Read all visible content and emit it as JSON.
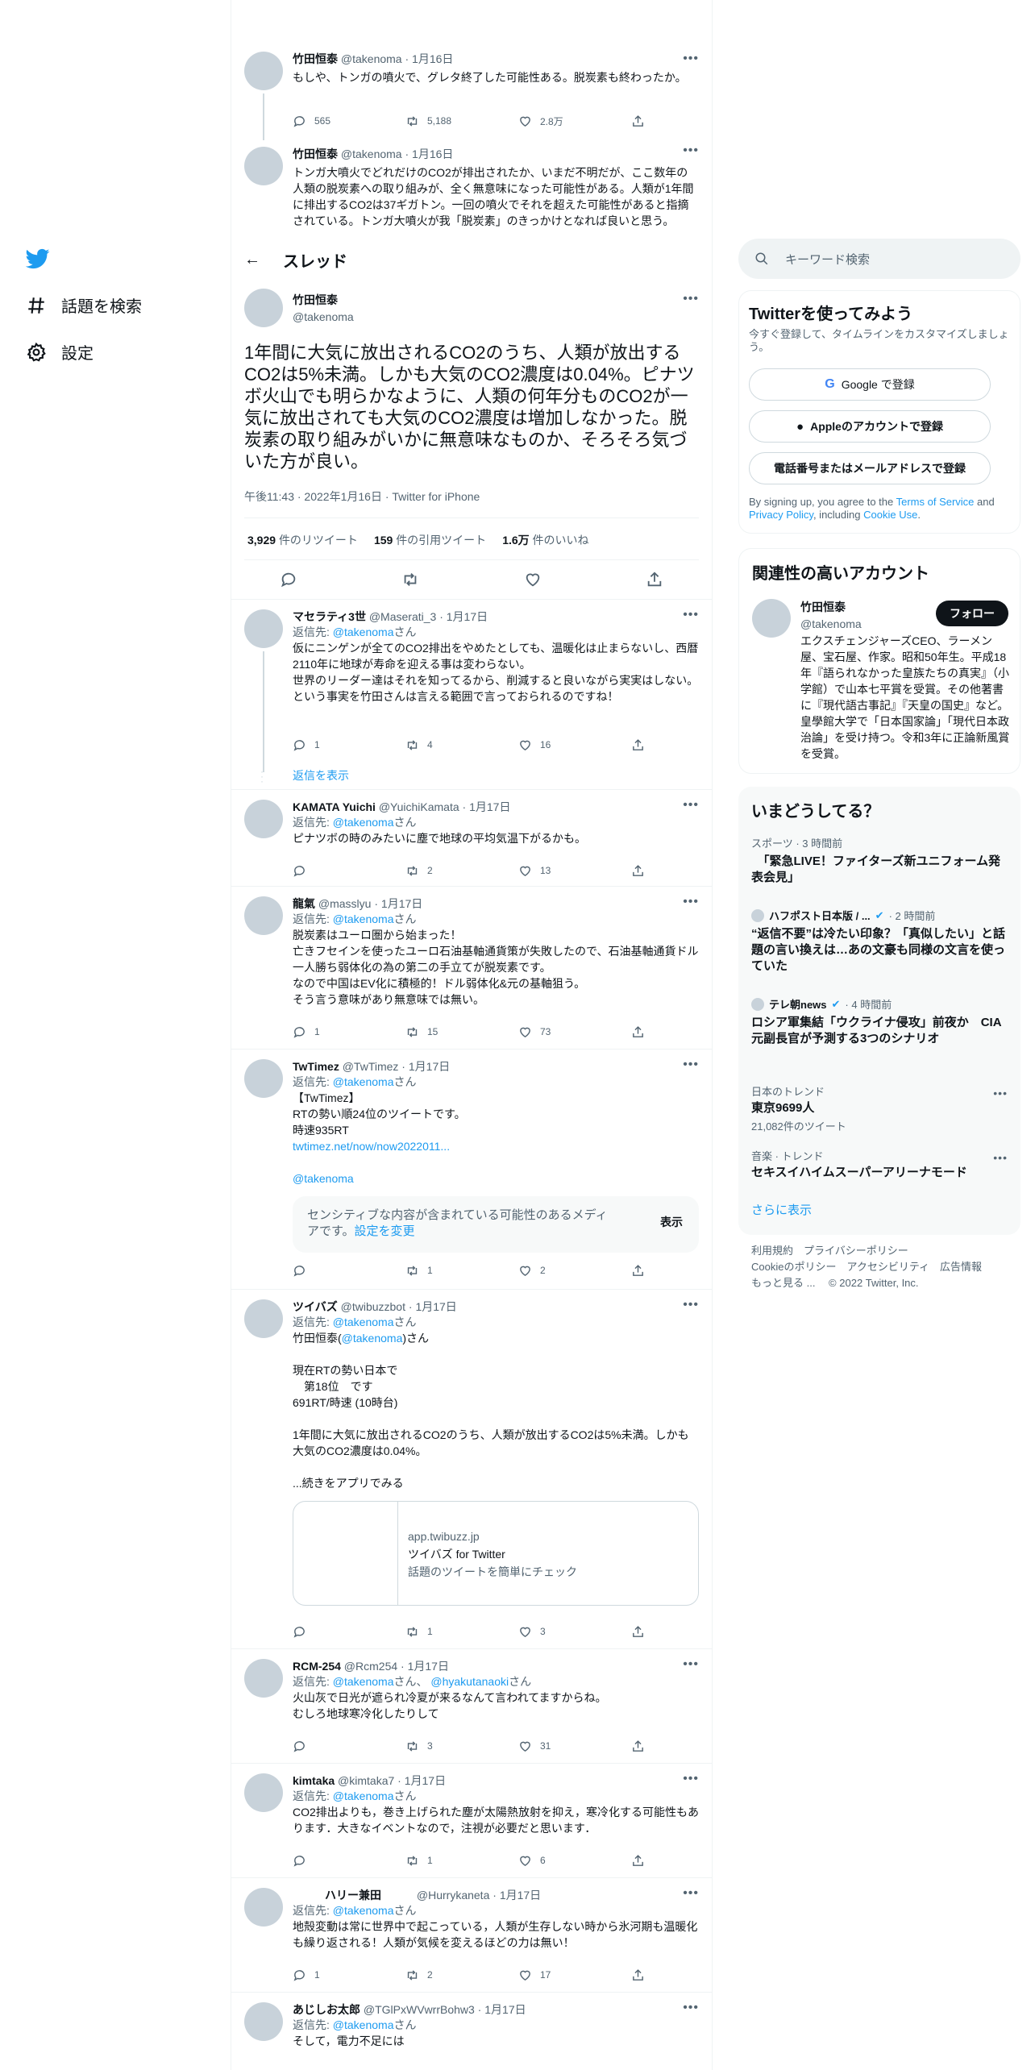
{
  "nav": {
    "explore_label": "話題を検索",
    "settings_label": "設定"
  },
  "thread_header": {
    "title": "スレッド"
  },
  "context_tweets": [
    {
      "name": "竹田恒泰",
      "handle": "@takenoma",
      "date": "1月16日",
      "text": "もしや、トンガの噴火で、グレタ終了した可能性ある。脱炭素も終わったか。",
      "replies": "565",
      "retweets": "5,188",
      "likes": "2.8万"
    },
    {
      "name": "竹田恒泰",
      "handle": "@takenoma",
      "date": "1月16日",
      "text": "トンガ大噴火でどれだけのCO2が排出されたか、いまだ不明だが、ここ数年の人類の脱炭素への取り組みが、全く無意味になった可能性がある。人類が1年間に排出するCO2は37ギガトン。一回の噴火でそれを超えた可能性があると指摘されている。トンガ大噴火が我「脱炭素」のきっかけとなれば良いと思う。"
    }
  ],
  "main_tweet": {
    "name": "竹田恒泰",
    "handle": "@takenoma",
    "text": "1年間に大気に放出されるCO2のうち、人類が放出するCO2は5%未満。しかも大気のCO2濃度は0.04%。ピナツボ火山でも明らかなように、人類の何年分ものCO2が一気に放出されても大気のCO2濃度は増加しなかった。脱炭素の取り組みがいかに無意味なものか、そろそろ気づいた方が良い。",
    "meta": "午後11:43 · 2022年1月16日 · Twitter for iPhone",
    "retweets_count": "3,929",
    "retweets_label": "件のリツイート",
    "quotes_count": "159",
    "quotes_label": "件の引用ツイート",
    "likes_count": "1.6万",
    "likes_label": "件のいいね"
  },
  "replies": [
    {
      "name": "マセラティ3世",
      "handle": "@Maserati_3",
      "date": "1月17日",
      "reply_prefix": "返信先:",
      "reply_to": "@takenoma",
      "reply_suffix": "さん",
      "text": "仮にニンゲンが全てのCO2排出をやめたとしても、温暖化は止まらないし、西暦2110年に地球が寿命を迎える事は変わらない。\n世界のリーダー達はそれを知ってるから、削減すると良いながら実実はしない。\nという事実を竹田さんは言える範囲で言っておられるのですね！",
      "replies": "1",
      "retweets": "4",
      "likes": "16",
      "show_replies": "返信を表示"
    },
    {
      "name": "KAMATA Yuichi",
      "handle": "@YuichiKamata",
      "date": "1月17日",
      "reply_prefix": "返信先:",
      "reply_to": "@takenoma",
      "reply_suffix": "さん",
      "text": "ピナツボの時のみたいに塵で地球の平均気温下がるかも。",
      "replies": "",
      "retweets": "2",
      "likes": "13"
    },
    {
      "name": "龍氣",
      "handle": "@masslyu",
      "date": "1月17日",
      "reply_prefix": "返信先:",
      "reply_to": "@takenoma",
      "reply_suffix": "さん",
      "text": "脱炭素はユーロ圏から始まった！\n亡きフセインを使ったユーロ石油基軸通貨策が失敗したので、石油基軸通貨ドル一人勝ち弱体化の為の第二の手立てが脱炭素です。\nなので中国はEV化に積極的！ドル弱体化&元の基軸狙う。\nそう言う意味があり無意味では無い。",
      "replies": "1",
      "retweets": "15",
      "likes": "73"
    },
    {
      "name": "TwTimez",
      "handle": "@TwTimez",
      "date": "1月17日",
      "reply_prefix": "返信先:",
      "reply_to": "@takenoma",
      "reply_suffix": "さん",
      "text": "【TwTimez】\nRTの勢い順24位のツイートです。\n時速935RT",
      "link": "twtimez.net/now/now2022011...",
      "mention": "@takenoma",
      "sensitive_text": "センシティブな内容が含まれている可能性のあるメディアです。",
      "sensitive_link": "設定を変更",
      "sensitive_show": "表示",
      "replies": "",
      "retweets": "1",
      "likes": "2"
    },
    {
      "name": "ツイバズ",
      "handle": "@twibuzzbot",
      "date": "1月17日",
      "reply_prefix": "返信先:",
      "reply_to": "@takenoma",
      "reply_suffix": "さん",
      "text_a": "竹田恒泰(",
      "text_mention": "@takenoma",
      "text_b": ")さん\n\n現在RTの勢い日本で\n　第18位　です\n691RT/時速 (10時台)\n\n1年間に大気に放出されるCO2のうち、人類が放出するCO2は5%未満。しかも大気のCO2濃度は0.04%。\n\n...続きをアプリでみる",
      "card_domain": "app.twibuzz.jp",
      "card_title": "ツイバズ for Twitter",
      "card_desc": "話題のツイートを簡単にチェック",
      "replies": "",
      "retweets": "1",
      "likes": "3"
    },
    {
      "name": "RCM-254",
      "handle": "@Rcm254",
      "date": "1月17日",
      "reply_prefix": "返信先:",
      "reply_to": "@takenoma",
      "reply_mid": "さん、",
      "reply_to2": "@hyakutanaoki",
      "reply_suffix": "さん",
      "text": "火山灰で日光が遮られ冷夏が来るなんて言われてますからね。\nむしろ地球寒冷化したりして",
      "replies": "",
      "retweets": "3",
      "likes": "31"
    },
    {
      "name": "kimtaka",
      "handle": "@kimtaka7",
      "date": "1月17日",
      "reply_prefix": "返信先:",
      "reply_to": "@takenoma",
      "reply_suffix": "さん",
      "text": "CO2排出よりも，巻き上げられた塵が太陽熱放射を抑え，寒冷化する可能性もあります．大きなイベントなので，注視が必要だと思います．",
      "replies": "",
      "retweets": "1",
      "likes": "6"
    },
    {
      "name": "ハリー兼田",
      "handle": "@Hurrykaneta",
      "date": "1月17日",
      "reply_prefix": "返信先:",
      "reply_to": "@takenoma",
      "reply_suffix": "さん",
      "text": "地殻変動は常に世界中で起こっている，人類が生存しない時から氷河期も温暖化も繰り返される！人類が気候を変えるほどの力は無い！",
      "replies": "1",
      "retweets": "2",
      "likes": "17"
    },
    {
      "name": "あじしお太郎",
      "handle": "@TGlPxWVwrrBohw3",
      "date": "1月17日",
      "reply_prefix": "返信先:",
      "reply_to": "@takenoma",
      "reply_suffix": "さん",
      "text": "そして，電力不足には"
    }
  ],
  "sidebar": {
    "search_placeholder": "キーワード検索",
    "signup": {
      "title": "Twitterを使ってみよう",
      "desc": "今すぐ登録して、タイムラインをカスタマイズしましょう。",
      "google_button": "Google で登録",
      "apple_button": "Appleのアカウントで登録",
      "phone_button": "電話番号またはメールアドレスで登録",
      "terms_a": "By signing up, you agree to the ",
      "terms_link1": "Terms of Service",
      "terms_b": " and ",
      "terms_link2": "Privacy Policy",
      "terms_c": ", including ",
      "terms_link3": "Cookie Use",
      "terms_d": "."
    },
    "related": {
      "title": "関連性の高いアカウント",
      "name": "竹田恒泰",
      "handle": "@takenoma",
      "follow_button": "フォロー",
      "bio": "エクスチェンジャーズCEO、ラーメン屋、宝石屋、作家。昭和50年生。平成18年『語られなかった皇族たちの真実』（小学館）で山本七平賞を受賞。その他著書に『現代語古事記』『天皇の国史』など。皇學館大学で「日本国家論」「現代日本政治論」を受け持つ。令和3年に正論新風賞を受賞。"
    },
    "trends": {
      "title": "いまどうしてる？",
      "items": [
        {
          "meta": "スポーツ · 3 時間前",
          "title": "　「緊急LIVE！ファイターズ新ユニフォーム発表会見」"
        },
        {
          "source": "ハフポスト日本版 / ...",
          "meta": "· 2 時間前",
          "title": "“返信不要”は冷たい印象？「真似したい」と話題の言い換えは…あの文豪も同様の文言を使っていた"
        },
        {
          "source": "テレ朝news",
          "meta": "· 4 時間前",
          "title": "ロシア軍集結「ウクライナ侵攻」前夜か　CIA元副長官が予測する3つのシナリオ"
        },
        {
          "meta": "日本のトレンド",
          "title": "東京9699人",
          "sub": "21,082件のツイート"
        },
        {
          "meta": "音楽 · トレンド",
          "title": "セキスイハイムスーパーアリーナモード"
        }
      ],
      "show_more": "さらに表示"
    },
    "footer": {
      "line1": "利用規約　プライバシーポリシー",
      "line2": "Cookieのポリシー　アクセシビリティ　広告情報",
      "line3": "もっと見る ...　 © 2022 Twitter, Inc."
    }
  },
  "colors": {
    "accent": "#1d9bf0",
    "text": "#0f1419",
    "muted": "#536471",
    "border": "#eff3f4"
  }
}
